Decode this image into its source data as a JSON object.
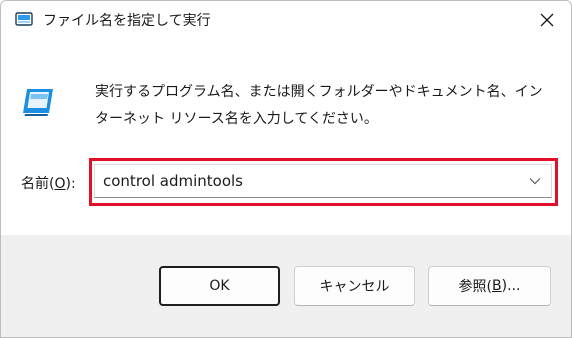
{
  "window": {
    "title": "ファイル名を指定して実行"
  },
  "description": "実行するプログラム名、または開くフォルダーやドキュメント名、インターネット リソース名を入力してください。",
  "open_field": {
    "label_prefix": "名前(",
    "label_mnemonic": "O",
    "label_suffix": "):",
    "value": "control admintools"
  },
  "buttons": {
    "ok": "OK",
    "cancel": "キャンセル",
    "browse_prefix": "参照(",
    "browse_mnemonic": "B",
    "browse_suffix": ")..."
  },
  "colors": {
    "highlight": "#e0102b",
    "icon_blue": "#1d8fe0"
  },
  "icons": {
    "title": "run-app-icon",
    "close": "close-icon",
    "main": "run-app-icon",
    "dropdown": "chevron-down-icon"
  }
}
